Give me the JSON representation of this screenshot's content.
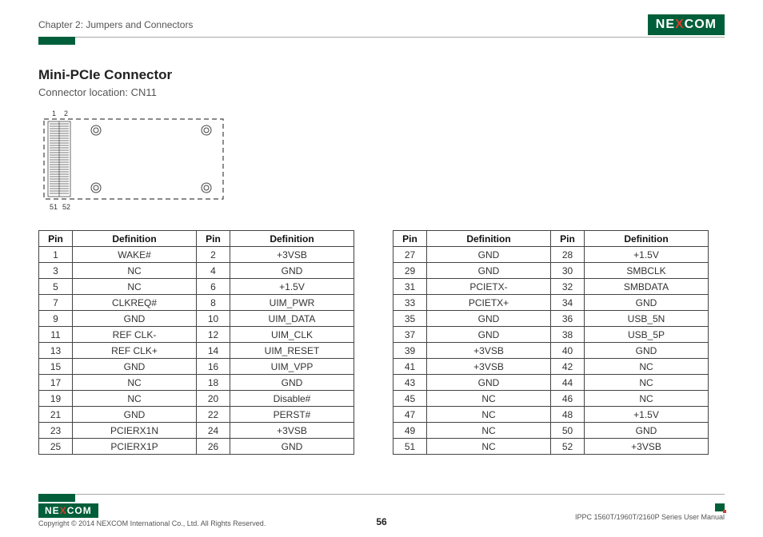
{
  "header": {
    "chapter": "Chapter 2: Jumpers and Connectors",
    "logo": "NEXCOM"
  },
  "title": "Mini-PCIe Connector",
  "subtitle": "Connector location: CN11",
  "diagram": {
    "top_left_label": "1",
    "top_right_label": "2",
    "bottom_left_label": "51",
    "bottom_right_label": "52"
  },
  "table_headers": [
    "Pin",
    "Definition",
    "Pin",
    "Definition"
  ],
  "left_table_rows": [
    [
      "1",
      "WAKE#",
      "2",
      "+3VSB"
    ],
    [
      "3",
      "NC",
      "4",
      "GND"
    ],
    [
      "5",
      "NC",
      "6",
      "+1.5V"
    ],
    [
      "7",
      "CLKREQ#",
      "8",
      "UIM_PWR"
    ],
    [
      "9",
      "GND",
      "10",
      "UIM_DATA"
    ],
    [
      "11",
      "REF CLK-",
      "12",
      "UIM_CLK"
    ],
    [
      "13",
      "REF CLK+",
      "14",
      "UIM_RESET"
    ],
    [
      "15",
      "GND",
      "16",
      "UIM_VPP"
    ],
    [
      "17",
      "NC",
      "18",
      "GND"
    ],
    [
      "19",
      "NC",
      "20",
      "Disable#"
    ],
    [
      "21",
      "GND",
      "22",
      "PERST#"
    ],
    [
      "23",
      "PCIERX1N",
      "24",
      "+3VSB"
    ],
    [
      "25",
      "PCIERX1P",
      "26",
      "GND"
    ]
  ],
  "right_table_rows": [
    [
      "27",
      "GND",
      "28",
      "+1.5V"
    ],
    [
      "29",
      "GND",
      "30",
      "SMBCLK"
    ],
    [
      "31",
      "PCIETX-",
      "32",
      "SMBDATA"
    ],
    [
      "33",
      "PCIETX+",
      "34",
      "GND"
    ],
    [
      "35",
      "GND",
      "36",
      "USB_5N"
    ],
    [
      "37",
      "GND",
      "38",
      "USB_5P"
    ],
    [
      "39",
      "+3VSB",
      "40",
      "GND"
    ],
    [
      "41",
      "+3VSB",
      "42",
      "NC"
    ],
    [
      "43",
      "GND",
      "44",
      "NC"
    ],
    [
      "45",
      "NC",
      "46",
      "NC"
    ],
    [
      "47",
      "NC",
      "48",
      "+1.5V"
    ],
    [
      "49",
      "NC",
      "50",
      "GND"
    ],
    [
      "51",
      "NC",
      "52",
      "+3VSB"
    ]
  ],
  "footer": {
    "copyright": "Copyright © 2014 NEXCOM International Co., Ltd. All Rights Reserved.",
    "pagenum": "56",
    "manual": "IPPC 1560T/1960T/2160P Series User Manual"
  }
}
